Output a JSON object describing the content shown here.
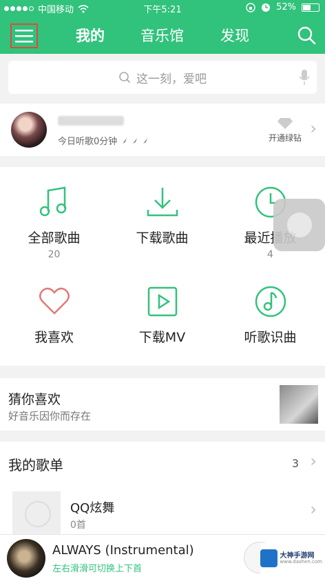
{
  "status_bar": {
    "carrier": "中国移动",
    "time": "下午5:21",
    "battery": "52%",
    "battery_level": 0.52
  },
  "nav": {
    "tabs": [
      {
        "label": "我的",
        "active": true
      },
      {
        "label": "音乐馆",
        "active": false
      },
      {
        "label": "发现",
        "active": false
      }
    ]
  },
  "search": {
    "placeholder": "这一刻，爱吧"
  },
  "profile": {
    "listen_text": "今日听歌0分钟",
    "vip_label": "开通绿钻"
  },
  "grid": [
    {
      "icon": "music-note-icon",
      "label": "全部歌曲",
      "count": "20"
    },
    {
      "icon": "download-icon",
      "label": "下载歌曲",
      "count": ""
    },
    {
      "icon": "clock-icon",
      "label": "最近播放",
      "count": "4"
    },
    {
      "icon": "heart-icon",
      "label": "我喜欢",
      "count": ""
    },
    {
      "icon": "play-video-icon",
      "label": "下载MV",
      "count": ""
    },
    {
      "icon": "music-recognize-icon",
      "label": "听歌识曲",
      "count": ""
    }
  ],
  "guess": {
    "title": "猜你喜欢",
    "subtitle": "好音乐因你而存在"
  },
  "playlists": {
    "title": "我的歌单",
    "count": "3",
    "items": [
      {
        "name": "QQ炫舞",
        "sub": "0首"
      }
    ]
  },
  "player": {
    "title": "ALWAYS (Instrumental)",
    "hint": "左右滑滑可切换上下首"
  },
  "watermark": {
    "text": "大神手游网",
    "sub": "www.dashen.com"
  },
  "colors": {
    "accent": "#31c27c",
    "menu_highlight": "#e0493f"
  }
}
